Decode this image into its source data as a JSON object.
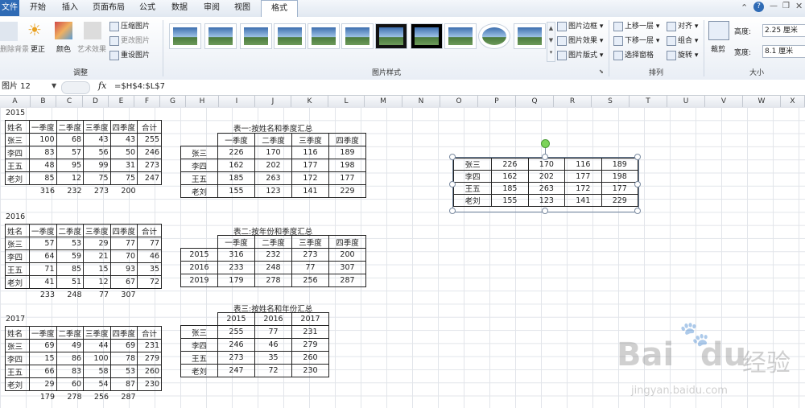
{
  "ribbon_tabs": [
    "文件",
    "开始",
    "插入",
    "页面布局",
    "公式",
    "数据",
    "审阅",
    "视图",
    "格式"
  ],
  "adjust_group": {
    "label": "调整",
    "remove_bg": "删除背景",
    "correct": "更正",
    "color": "颜色",
    "artistic": "艺术效果",
    "compress": "压缩图片",
    "change": "更改图片",
    "reset": "重设图片"
  },
  "picture_styles": {
    "label": "图片样式",
    "border": "图片边框",
    "effects": "图片效果",
    "layout": "图片版式"
  },
  "arrange": {
    "label": "排列",
    "bring_forward": "上移一层",
    "send_backward": "下移一层",
    "selection_pane": "选择窗格",
    "align": "对齐",
    "group": "组合",
    "rotate": "旋转"
  },
  "size": {
    "label": "大小",
    "crop": "裁剪",
    "height_label": "高度:",
    "height_value": "2.25 厘米",
    "width_label": "宽度:",
    "width_value": "8.1 厘米"
  },
  "name_box": "图片 12",
  "formula": "=$H$4:$L$7",
  "columns": [
    "A",
    "B",
    "C",
    "D",
    "E",
    "F",
    "G",
    "H",
    "I",
    "J",
    "K",
    "L",
    "M",
    "N",
    "O",
    "P",
    "Q",
    "R",
    "S",
    "T",
    "U",
    "V",
    "W",
    "X"
  ],
  "left_tables": [
    {
      "year": "2015",
      "header": [
        "姓名",
        "一季度",
        "二季度",
        "三季度",
        "四季度",
        "合计"
      ],
      "rows": [
        [
          "张三",
          "100",
          "68",
          "43",
          "43",
          "255"
        ],
        [
          "李四",
          "83",
          "57",
          "56",
          "50",
          "246"
        ],
        [
          "王五",
          "48",
          "95",
          "99",
          "31",
          "273"
        ],
        [
          "老刘",
          "85",
          "12",
          "75",
          "75",
          "247"
        ]
      ],
      "totals": [
        "316",
        "232",
        "273",
        "200"
      ]
    },
    {
      "year": "2016",
      "header": [
        "姓名",
        "一季度",
        "二季度",
        "三季度",
        "四季度",
        "合计"
      ],
      "rows": [
        [
          "张三",
          "57",
          "53",
          "29",
          "77",
          "77"
        ],
        [
          "李四",
          "64",
          "59",
          "21",
          "70",
          "46"
        ],
        [
          "王五",
          "71",
          "85",
          "15",
          "93",
          "35"
        ],
        [
          "老刘",
          "41",
          "51",
          "12",
          "67",
          "72"
        ]
      ],
      "totals": [
        "233",
        "248",
        "77",
        "307"
      ]
    },
    {
      "year": "2017",
      "header": [
        "姓名",
        "一季度",
        "二季度",
        "三季度",
        "四季度",
        "合计"
      ],
      "rows": [
        [
          "张三",
          "69",
          "49",
          "44",
          "69",
          "231"
        ],
        [
          "李四",
          "15",
          "86",
          "100",
          "78",
          "279"
        ],
        [
          "王五",
          "66",
          "83",
          "58",
          "53",
          "260"
        ],
        [
          "老刘",
          "29",
          "60",
          "54",
          "87",
          "230"
        ]
      ],
      "totals": [
        "179",
        "278",
        "256",
        "287"
      ]
    }
  ],
  "summary1": {
    "title": "表一:按姓名和季度汇总",
    "header": [
      "一季度",
      "二季度",
      "三季度",
      "四季度"
    ],
    "rows": [
      [
        "张三",
        "226",
        "170",
        "116",
        "189"
      ],
      [
        "李四",
        "162",
        "202",
        "177",
        "198"
      ],
      [
        "王五",
        "185",
        "263",
        "172",
        "177"
      ],
      [
        "老刘",
        "155",
        "123",
        "141",
        "229"
      ]
    ]
  },
  "summary2": {
    "title": "表二:按年份和季度汇总",
    "header": [
      "一季度",
      "二季度",
      "三季度",
      "四季度"
    ],
    "rows": [
      [
        "2015",
        "316",
        "232",
        "273",
        "200"
      ],
      [
        "2016",
        "233",
        "248",
        "77",
        "307"
      ],
      [
        "2019",
        "179",
        "278",
        "256",
        "287"
      ]
    ]
  },
  "summary3": {
    "title": "表三:按姓名和年份汇总",
    "header": [
      "2015",
      "2016",
      "2017"
    ],
    "rows": [
      [
        "张三",
        "255",
        "77",
        "231"
      ],
      [
        "李四",
        "246",
        "46",
        "279"
      ],
      [
        "王五",
        "273",
        "35",
        "260"
      ],
      [
        "老刘",
        "247",
        "72",
        "230"
      ]
    ]
  },
  "picture_table": {
    "rows": [
      [
        "张三",
        "226",
        "170",
        "116",
        "189"
      ],
      [
        "李四",
        "162",
        "202",
        "177",
        "198"
      ],
      [
        "王五",
        "185",
        "263",
        "172",
        "177"
      ],
      [
        "老刘",
        "155",
        "123",
        "141",
        "229"
      ]
    ]
  },
  "watermark": {
    "brand": "Bai",
    "brand2": "du",
    "cn": "经验",
    "url": "jingyan.baidu.com"
  }
}
